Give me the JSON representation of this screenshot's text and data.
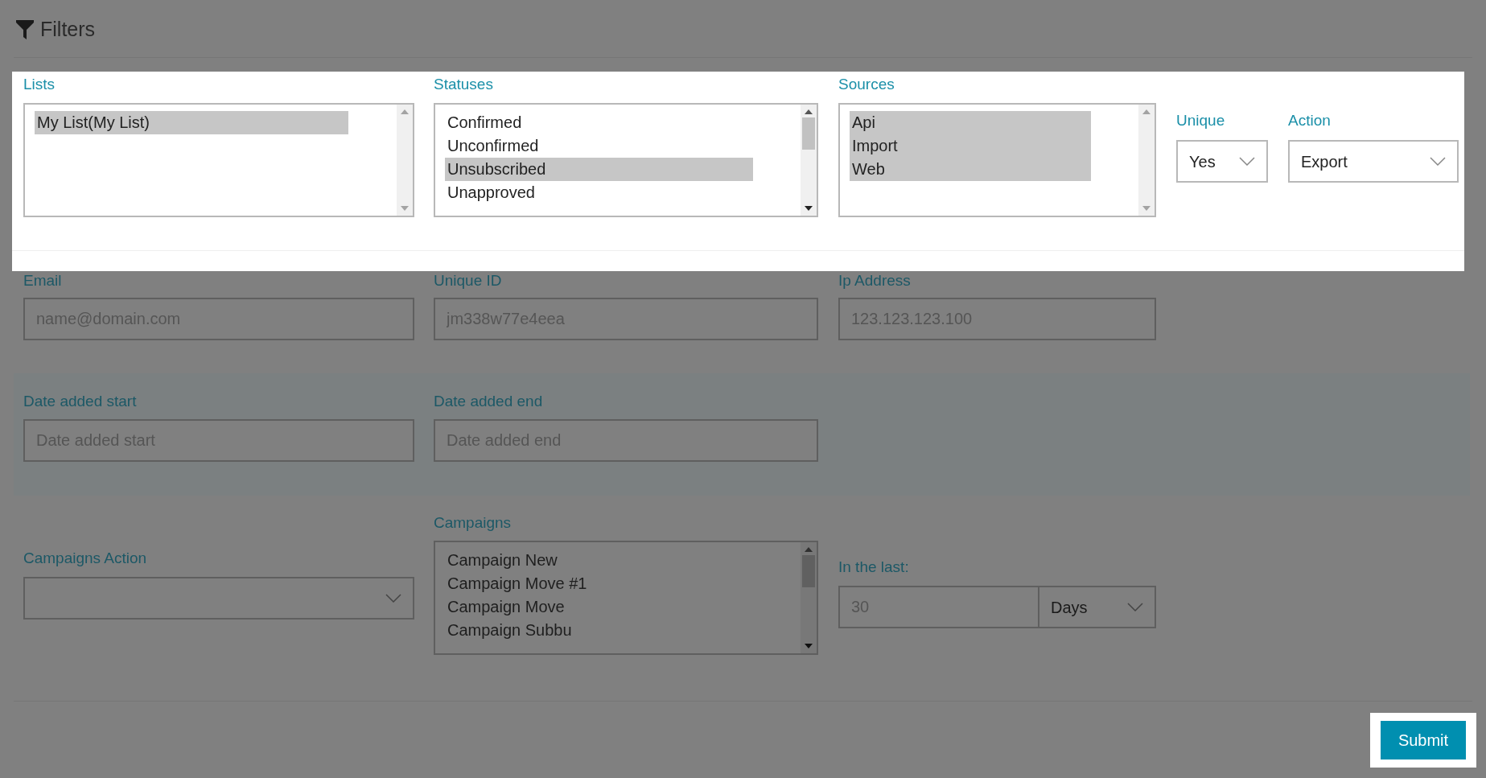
{
  "header": {
    "title": "Filters"
  },
  "top_row": {
    "highlighted": true,
    "lists": {
      "label": "Lists",
      "items": [
        {
          "text": "My List(My List)",
          "selected": true
        }
      ]
    },
    "statuses": {
      "label": "Statuses",
      "items": [
        {
          "text": "Confirmed",
          "selected": false
        },
        {
          "text": "Unconfirmed",
          "selected": false
        },
        {
          "text": "Unsubscribed",
          "selected": true
        },
        {
          "text": "Unapproved",
          "selected": false
        }
      ]
    },
    "sources": {
      "label": "Sources",
      "items": [
        {
          "text": "Api",
          "selected": true
        },
        {
          "text": "Import",
          "selected": true
        },
        {
          "text": "Web",
          "selected": true
        }
      ]
    },
    "unique": {
      "label": "Unique",
      "value": "Yes"
    },
    "action": {
      "label": "Action",
      "value": "Export"
    }
  },
  "contact_row": {
    "highlighted": false,
    "email": {
      "label": "Email",
      "placeholder": "name@domain.com"
    },
    "unique_id": {
      "label": "Unique ID",
      "placeholder": "jm338w77e4eea"
    },
    "ip_address": {
      "label": "Ip Address",
      "placeholder": "123.123.123.100"
    }
  },
  "date_row": {
    "highlighted": false,
    "start": {
      "label": "Date added start",
      "placeholder": "Date added start"
    },
    "end": {
      "label": "Date added end",
      "placeholder": "Date added end"
    }
  },
  "campaign_row": {
    "highlighted": false,
    "campaigns_action": {
      "label": "Campaigns Action"
    },
    "campaigns": {
      "label": "Campaigns",
      "items": [
        {
          "text": "Campaign New",
          "selected": false
        },
        {
          "text": "Campaign Move #1",
          "selected": false
        },
        {
          "text": "Campaign Move",
          "selected": false
        },
        {
          "text": "Campaign Subbu",
          "selected": false
        }
      ]
    },
    "in_the_last": {
      "label": "In the last:",
      "placeholder": "30",
      "unit": "Days"
    }
  },
  "submit": {
    "label": "Submit",
    "highlighted": true
  }
}
